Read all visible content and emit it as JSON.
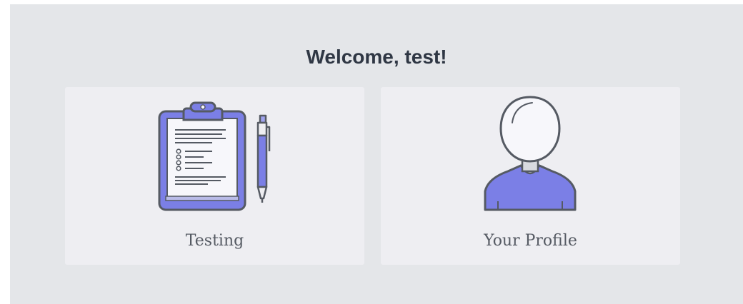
{
  "header": {
    "title": "Welcome, test!"
  },
  "cards": [
    {
      "label": "Testing",
      "icon": "clipboard-pen-icon"
    },
    {
      "label": "Your Profile",
      "icon": "user-profile-icon"
    }
  ],
  "colors": {
    "background": "#e4e6e9",
    "card": "#eeeef2",
    "accent": "#7b7fe6",
    "outline": "#555a63",
    "title": "#2f3744"
  }
}
